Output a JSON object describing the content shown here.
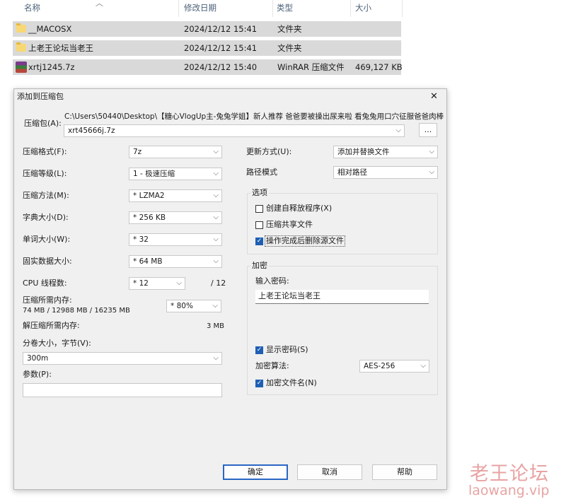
{
  "explorer": {
    "columns": [
      "名称",
      "修改日期",
      "类型",
      "大小"
    ],
    "rows": [
      {
        "name": "__MACOSX",
        "date": "2024/12/12 15:41",
        "type": "文件夹",
        "size": "",
        "icon": "folder-icon"
      },
      {
        "name": "上老王论坛当老王",
        "date": "2024/12/12 15:41",
        "type": "文件夹",
        "size": "",
        "icon": "folder-icon"
      },
      {
        "name": "xrtj1245.7z",
        "date": "2024/12/12 15:40",
        "type": "WinRAR 压缩文件",
        "size": "469,127 KB",
        "icon": "winrar-archive-icon"
      }
    ]
  },
  "dialog": {
    "title": "添加到压缩包",
    "close_glyph": "✕",
    "archive": {
      "label": "压缩包(A):",
      "path": "C:\\Users\\50440\\Desktop\\【糖心VlogUp主-兔兔学姐】新人推荐 爸爸要被操出尿来啦 看兔兔用口穴征服爸爸肉棒",
      "filename": "xrt45666j.7z",
      "browse_label": "..."
    },
    "left": {
      "format_label": "压缩格式(F):",
      "format_value": "7z",
      "level_label": "压缩等级(L):",
      "level_value": "1 - 极速压缩",
      "method_label": "压缩方法(M):",
      "method_value": "* LZMA2",
      "dict_label": "字典大小(D):",
      "dict_value": "* 256 KB",
      "word_label": "单词大小(W):",
      "word_value": "* 32",
      "solid_label": "固实数据大小:",
      "solid_value": "* 64 MB",
      "cpu_label": "CPU 线程数:",
      "cpu_value": "* 12",
      "cpu_max": "/ 12",
      "mem_label": "压缩所需内存:",
      "mem_detail": "74 MB / 12988 MB / 16235 MB",
      "mem_percent": "* 80%",
      "decomp_label": "解压缩所需内存:",
      "decomp_value": "3 MB",
      "split_label": "分卷大小，字节(V):",
      "split_value": "300m",
      "params_label": "参数(P):",
      "params_value": ""
    },
    "right": {
      "update_label": "更新方式(U):",
      "update_value": "添加并替换文件",
      "pathmode_label": "路径模式",
      "pathmode_value": "相对路径",
      "options_title": "选项",
      "opt_sfx": "创建自释放程序(X)",
      "opt_shared": "压缩共享文件",
      "opt_delete": "操作完成后删除源文件",
      "enc_title": "加密",
      "password_label": "输入密码:",
      "password_value": "上老王论坛当老王",
      "show_pwd": "显示密码(S)",
      "method_label": "加密算法:",
      "method_value": "AES-256",
      "encrypt_names": "加密文件名(N)"
    },
    "checks": {
      "sfx": false,
      "shared": false,
      "delete": true,
      "show_pwd": true,
      "encrypt_names": true
    },
    "buttons": {
      "ok": "确定",
      "cancel": "取消",
      "help": "帮助"
    },
    "check_glyph": "✓",
    "arrow_glyph": "⌵"
  },
  "watermark": {
    "cn": "老王论坛",
    "url": "laowang.vip",
    "color": "#e8a3a3"
  }
}
